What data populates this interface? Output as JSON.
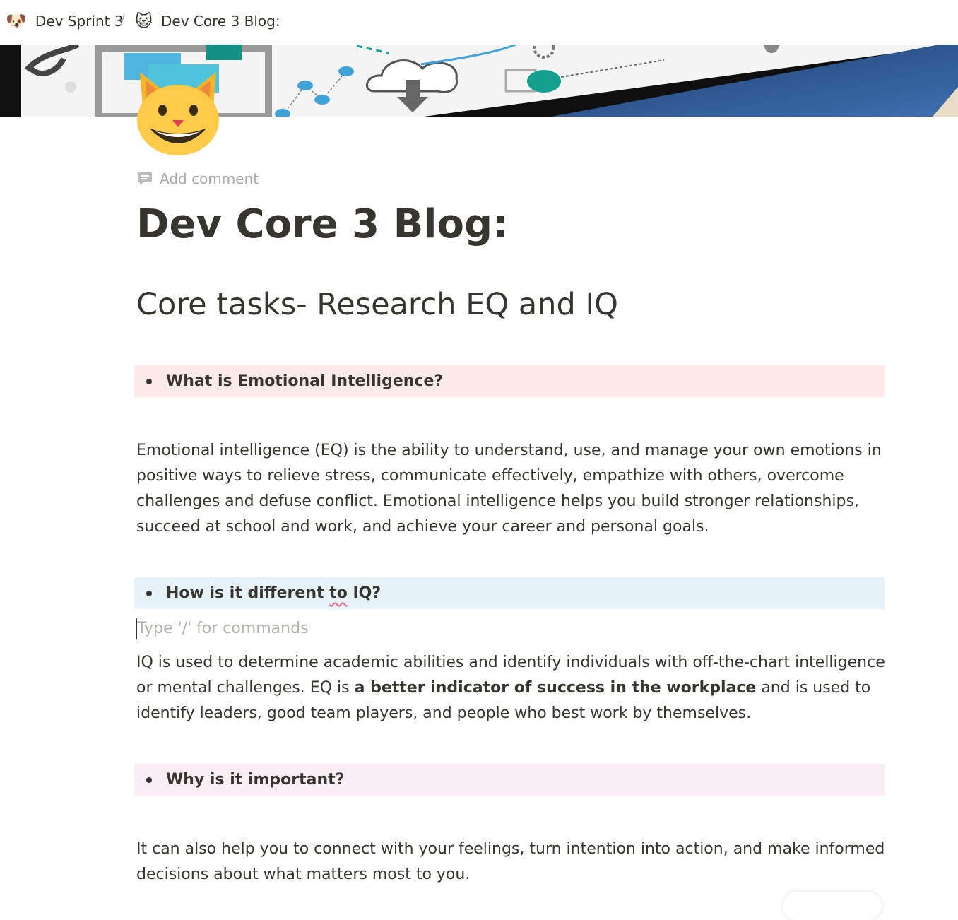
{
  "breadcrumb": {
    "items": [
      {
        "icon": "dog-face-icon",
        "emoji": "🐶",
        "label": "Dev Sprint 3"
      },
      {
        "icon": "cat-face-icon",
        "emoji": "😺",
        "label": "Dev Core 3 Blog:"
      }
    ],
    "separator": "/"
  },
  "page": {
    "icon": "smiling-cat-icon",
    "add_comment": "Add comment",
    "title": "Dev Core 3 Blog:",
    "heading": "Core tasks- Research EQ and IQ"
  },
  "blocks": {
    "q1": "What is Emotional Intelligence?",
    "p1": "Emotional intelligence (EQ) is the ability to understand, use, and manage your own emotions in positive ways to relieve stress, communicate effectively, empathize with others, overcome challenges and defuse conflict. Emotional intelligence helps you build stronger relationships, succeed at school and work, and achieve your career and personal goals.",
    "q2_before": "How is it different ",
    "q2_underlined": "to",
    "q2_after": " IQ?",
    "placeholder": "Type '/' for commands",
    "p2_before": "IQ is used to determine academic abilities and identify individuals with off-the-chart intelligence or mental challenges. EQ is ",
    "p2_bold": "a better indicator of success in the workplace",
    "p2_after": " and is used to identify leaders, good team players, and people who best work by themselves.",
    "q3": "Why is it important?",
    "p3": "It can also help you to connect with your feelings, turn intention into action, and make informed decisions about what matters most to you."
  },
  "colors": {
    "callout_red": "#fdebec",
    "callout_blue": "#e7f3f8",
    "callout_pink": "#f9eef3",
    "text": "#37352f",
    "muted": "#a9a8a4"
  }
}
